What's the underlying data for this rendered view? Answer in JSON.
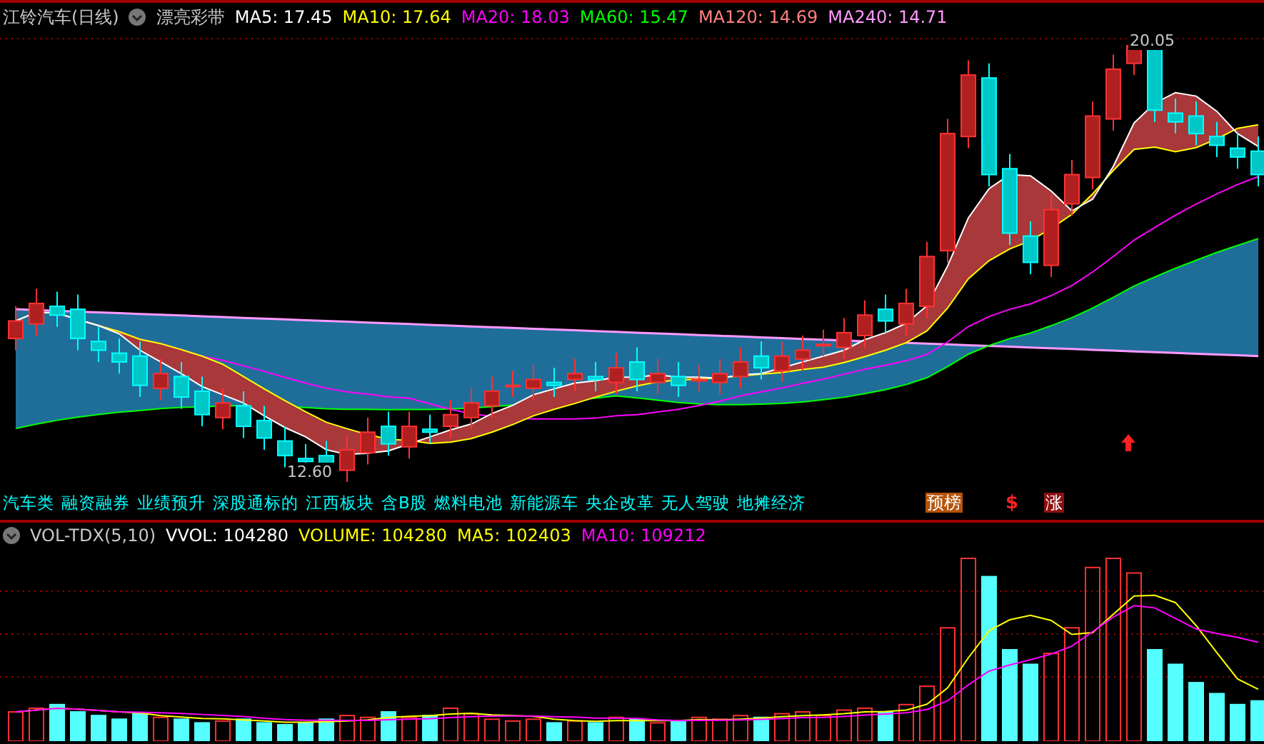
{
  "header": {
    "title": "江铃汽车(日线)",
    "indicator": "漂亮彩带",
    "ma_values": [
      {
        "text": "MA5: 17.45",
        "color": "#ffffff"
      },
      {
        "text": "MA10: 17.64",
        "color": "#ffff00"
      },
      {
        "text": "MA20: 18.03",
        "color": "#ff00ff"
      },
      {
        "text": "MA60: 15.47",
        "color": "#00ff00"
      },
      {
        "text": "MA120: 14.69",
        "color": "#ff8080"
      },
      {
        "text": "MA240: 14.71",
        "color": "#ff99ff"
      }
    ]
  },
  "price_chart": {
    "high_label": "20.05",
    "low_label": "12.60"
  },
  "concept_tags": [
    "汽车类",
    "融资融券",
    "业绩预升",
    "深股通标的",
    "江西板块",
    "含B股",
    "燃料电池",
    "新能源车",
    "央企改革",
    "无人驾驶",
    "地摊经济"
  ],
  "badges": [
    {
      "kind": "box",
      "text": "预榜",
      "color": "#b4540c"
    },
    {
      "kind": "plain",
      "text": "$",
      "color": "#ff2020"
    },
    {
      "kind": "box",
      "text": "涨",
      "color": "#8c1010"
    }
  ],
  "volume": {
    "indicator": "VOL-TDX(5,10)",
    "values": [
      {
        "text": "VVOL: 104280",
        "color": "#ffffff"
      },
      {
        "text": "VOLUME: 104280",
        "color": "#ffff00"
      },
      {
        "text": "MA5: 102403",
        "color": "#ffff00"
      },
      {
        "text": "MA10: 109212",
        "color": "#ff00ff"
      }
    ]
  }
}
